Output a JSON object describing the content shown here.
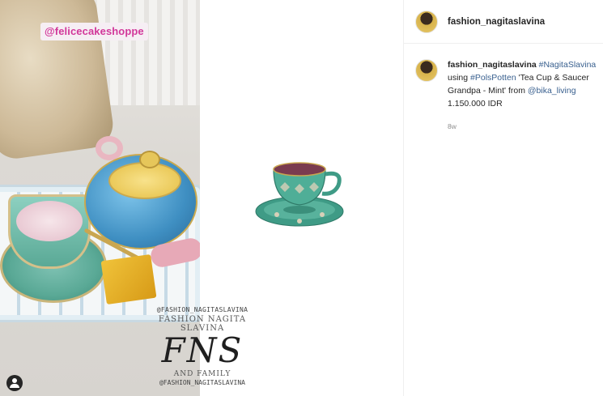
{
  "media": {
    "tag_label": "@felicecakeshoppe",
    "watermark": {
      "top": "@FASHION_NAGITASLAVINA",
      "name": "FASHION NAGITA SLAVINA",
      "logo": "FNS",
      "family": "AND FAMILY",
      "bottom": "@FASHION_NAGITASLAVINA"
    },
    "user_tags_icon": "user-circle-icon"
  },
  "header": {
    "username": "fashion_nagitaslavina"
  },
  "caption": {
    "username": "fashion_nagitaslavina",
    "line1_hashtag": "#NagitaSlavina",
    "line2_prefix": "using",
    "line2_hashtag": "#PolsPotten",
    "line2_text": "'Tea Cup & Saucer",
    "line3_text": "Grandpa - Mint' from",
    "line3_mention": "@bika_living",
    "line4_price": "1.150.000 IDR",
    "time": "8w"
  },
  "colors": {
    "tag_text": "#d2379a",
    "link_blue": "#385f8e",
    "muted": "#8e8e8e"
  }
}
